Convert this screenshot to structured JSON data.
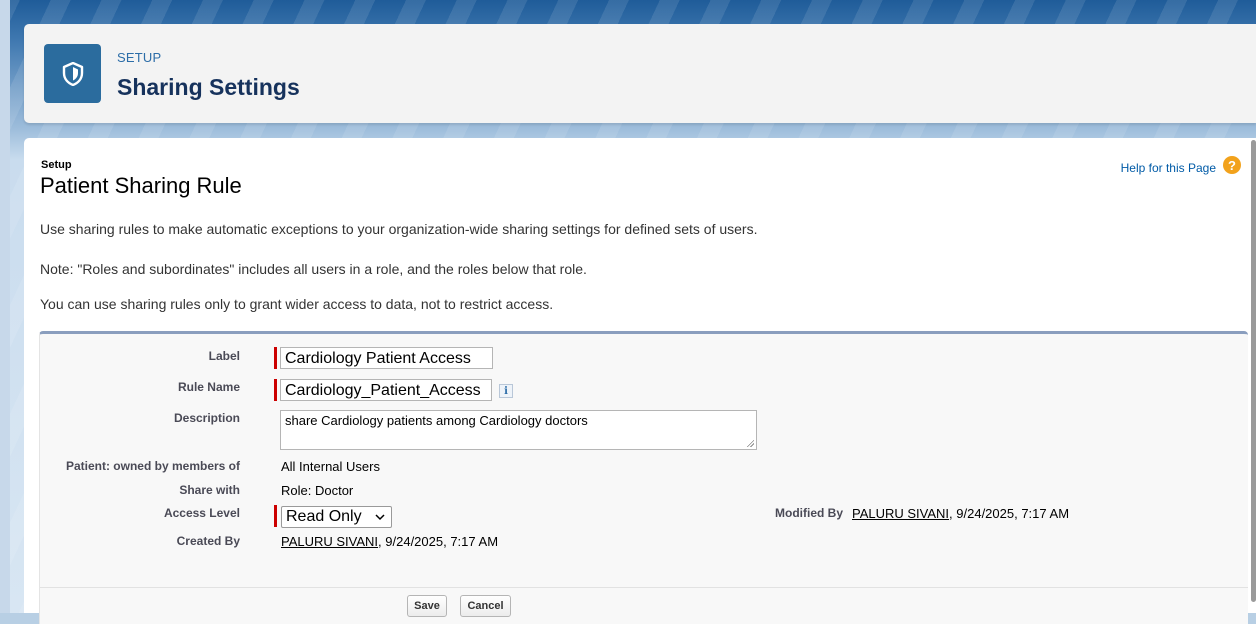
{
  "header": {
    "eyebrow": "SETUP",
    "title": "Sharing Settings",
    "icon": "shield-icon"
  },
  "page": {
    "breadcrumb": "Setup",
    "title": "Patient Sharing Rule",
    "help_link": "Help for this Page",
    "help_icon_glyph": "?",
    "paragraphs": [
      "Use sharing rules to make automatic exceptions to your organization-wide sharing settings for defined sets of users.",
      "Note: \"Roles and subordinates\" includes all users in a role, and the roles below that role.",
      "You can use sharing rules only to grant wider access to data, not to restrict access."
    ]
  },
  "form": {
    "label_label": "Label",
    "label_value": "Cardiology Patient Access",
    "rule_name_label": "Rule Name",
    "rule_name_value": "Cardiology_Patient_Access",
    "info_glyph": "i",
    "description_label": "Description",
    "description_value": "share Cardiology patients among Cardiology doctors",
    "owned_by_label": "Patient: owned by members of",
    "owned_by_value": "All Internal Users",
    "share_with_label": "Share with",
    "share_with_value": "Role: Doctor",
    "access_level_label": "Access Level",
    "access_level_value": "Read Only",
    "created_by_label": "Created By",
    "created_by_user": "PALURU SIVANI",
    "created_by_date": ", 9/24/2025, 7:17 AM",
    "modified_by_label": "Modified By",
    "modified_by_user": "PALURU SIVANI",
    "modified_by_date": ", 9/24/2025, 7:17 AM"
  },
  "buttons": {
    "save": "Save",
    "cancel": "Cancel"
  },
  "colors": {
    "header_icon_bg": "#2b6c9e",
    "required_bar": "#cc0000",
    "help_icon": "#f2a21c"
  }
}
